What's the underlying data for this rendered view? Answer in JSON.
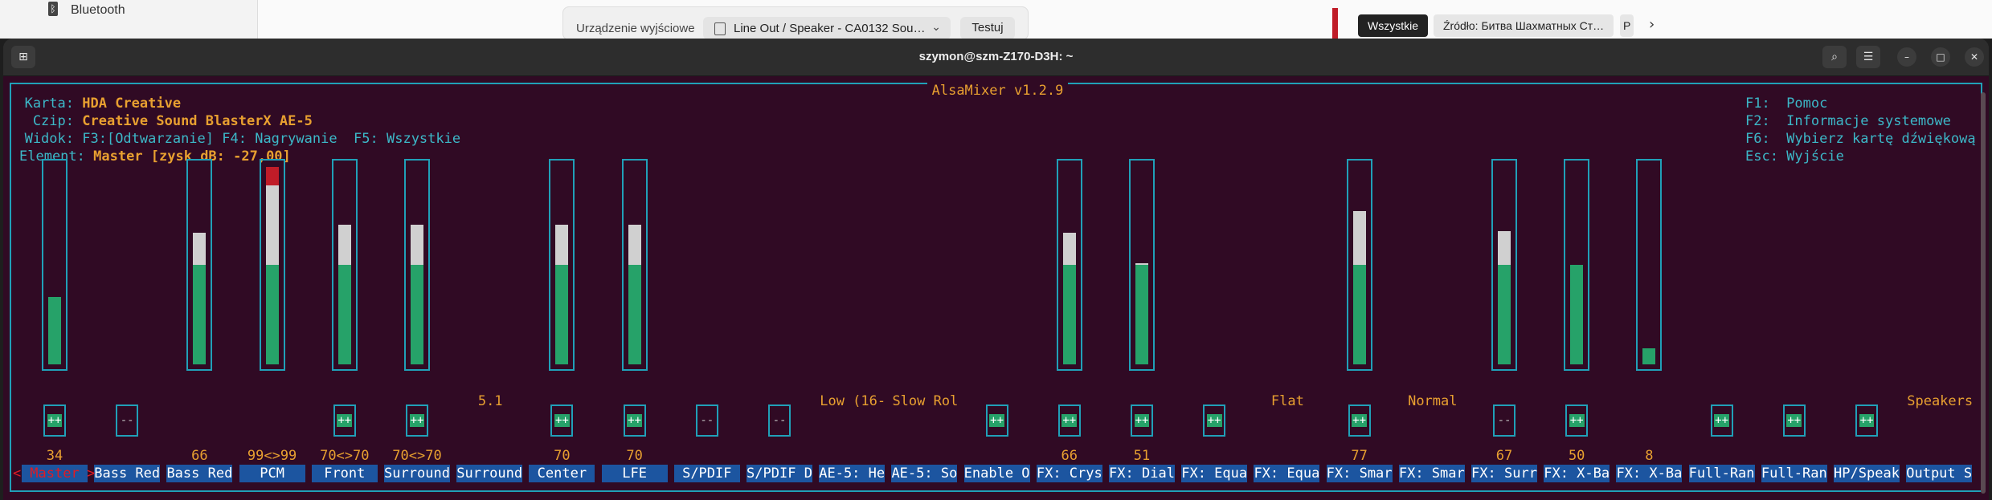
{
  "settings_bg": {
    "bluetooth_label": "Bluetooth"
  },
  "output_panel": {
    "label": "Urządzenie wyjściowe",
    "selected": "Line Out / Speaker - CA0132 Sou…",
    "test_button": "Testuj"
  },
  "browser_tabs": [
    {
      "label": "Wszystkie",
      "active": true
    },
    {
      "label": "Źródło: Битва Шахматных Ст…",
      "active": false
    },
    {
      "label": "P",
      "active": false
    }
  ],
  "terminal": {
    "title": "szymon@szm-Z170-D3H: ~"
  },
  "alsamixer": {
    "frame_title": "AlsaMixer v1.2.9",
    "card_key": "Karta:",
    "card_value": "HDA Creative",
    "chip_key": "Czip:",
    "chip_value": "Creative Sound BlasterX AE-5",
    "view_key": "Widok:",
    "view_f3": "F3:[Odtwarzanie]",
    "view_f4": "F4: Nagrywanie",
    "view_f5": "F5: Wszystkie",
    "element_key": "Element:",
    "element_value": "Master [zysk dB: -27,00]",
    "help": [
      "F1:  Pomoc",
      "F2:  Informacje systemowe",
      "F6:  Wybierz kartę dźwiękową",
      "Esc: Wyjście"
    ],
    "channels": [
      {
        "label": "Master",
        "value_text": "34",
        "level": 0.34,
        "switch": "on"
      },
      {
        "label": "Bass Red",
        "switch": "off"
      },
      {
        "label": "Bass Red",
        "value_text": "66",
        "level": 0.66
      },
      {
        "label": "PCM",
        "value_text": "99<>99",
        "level": 0.99
      },
      {
        "label": "Front",
        "value_text": "70<>70",
        "level": 0.7,
        "switch": "on"
      },
      {
        "label": "Surround",
        "value_text": "70<>70",
        "level": 0.7,
        "switch": "on"
      },
      {
        "label": "Surround",
        "enum_value": "5.1"
      },
      {
        "label": "Center",
        "value_text": "70",
        "level": 0.7,
        "switch": "on"
      },
      {
        "label": "LFE",
        "value_text": "70",
        "level": 0.7,
        "switch": "on"
      },
      {
        "label": "S/PDIF",
        "switch": "off"
      },
      {
        "label": "S/PDIF D",
        "switch": "off"
      },
      {
        "label": "AE-5: He",
        "enum_value": "Low (16-"
      },
      {
        "label": "AE-5: So",
        "enum_value": "Slow Rol"
      },
      {
        "label": "Enable O",
        "switch": "on"
      },
      {
        "label": "FX: Crys",
        "value_text": "66",
        "level": 0.66,
        "switch": "on"
      },
      {
        "label": "FX: Dial",
        "value_text": "51",
        "level": 0.51,
        "switch": "on"
      },
      {
        "label": "FX: Equa",
        "switch": "on"
      },
      {
        "label": "FX: Equa",
        "enum_value": "Flat"
      },
      {
        "label": "FX: Smar",
        "value_text": "77",
        "level": 0.77,
        "switch": "on"
      },
      {
        "label": "FX: Smar",
        "enum_value": "Normal"
      },
      {
        "label": "FX: Surr",
        "value_text": "67",
        "level": 0.67,
        "switch": "off"
      },
      {
        "label": "FX: X-Ba",
        "value_text": "50",
        "level": 0.5,
        "switch": "on"
      },
      {
        "label": "FX: X-Ba",
        "value_text": "8",
        "level": 0.08
      },
      {
        "label": "Full-Ran",
        "switch": "on"
      },
      {
        "label": "Full-Ran",
        "switch": "on"
      },
      {
        "label": "HP/Speak",
        "switch": "on"
      },
      {
        "label": "Output S",
        "enum_value": "Speakers"
      }
    ],
    "switch_on_text": "++",
    "switch_off_text": "--",
    "selector_left": "<",
    "selector_right": ">"
  },
  "colors": {
    "terminal_bg": "#300a24",
    "accent_cyan": "#20a0b8",
    "value_orange": "#e8a030",
    "meter_green": "#26a269",
    "meter_white": "#d0d0d0",
    "meter_red": "#c01c28",
    "label_blue": "#1c55a0"
  }
}
